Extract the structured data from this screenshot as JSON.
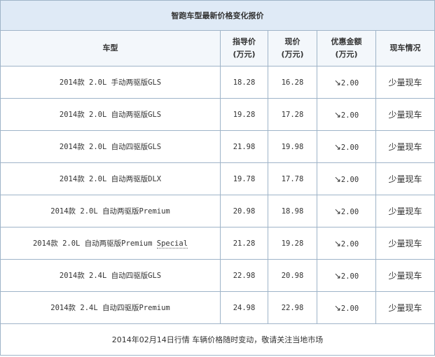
{
  "title": "智跑车型最新价格变化报价",
  "headers": {
    "model": "车型",
    "guide_price": [
      "指导价",
      "(万元)"
    ],
    "current_price": [
      "现价",
      "(万元)"
    ],
    "discount": [
      "优惠金额",
      "(万元)"
    ],
    "stock": "现车情况"
  },
  "rows": [
    {
      "model_main": "2014款 2.0L 手动两驱版GLS",
      "model_extra": "",
      "guide": "18.28",
      "current": "16.28",
      "discount_arrow": "↘",
      "discount": "2.00",
      "stock": "少量现车"
    },
    {
      "model_main": "2014款 2.0L 自动两驱版GLS",
      "model_extra": "",
      "guide": "19.28",
      "current": "17.28",
      "discount_arrow": "↘",
      "discount": "2.00",
      "stock": "少量现车"
    },
    {
      "model_main": "2014款 2.0L 自动四驱版GLS",
      "model_extra": "",
      "guide": "21.98",
      "current": "19.98",
      "discount_arrow": "↘",
      "discount": "2.00",
      "stock": "少量现车"
    },
    {
      "model_main": "2014款 2.0L 自动两驱版DLX",
      "model_extra": "",
      "guide": "19.78",
      "current": "17.78",
      "discount_arrow": "↘",
      "discount": "2.00",
      "stock": "少量现车"
    },
    {
      "model_main": "2014款 2.0L 自动两驱版Premium",
      "model_extra": "",
      "guide": "20.98",
      "current": "18.98",
      "discount_arrow": "↘",
      "discount": "2.00",
      "stock": "少量现车"
    },
    {
      "model_main": "2014款 2.0L 自动两驱版Premium ",
      "model_extra": "Special",
      "guide": "21.28",
      "current": "19.28",
      "discount_arrow": "↘",
      "discount": "2.00",
      "stock": "少量现车"
    },
    {
      "model_main": "2014款 2.4L 自动四驱版GLS",
      "model_extra": "",
      "guide": "22.98",
      "current": "20.98",
      "discount_arrow": "↘",
      "discount": "2.00",
      "stock": "少量现车"
    },
    {
      "model_main": "2014款 2.4L 自动四驱版Premium",
      "model_extra": "",
      "guide": "24.98",
      "current": "22.98",
      "discount_arrow": "↘",
      "discount": "2.00",
      "stock": "少量现车"
    }
  ],
  "footer": "2014年02月14日行情 车辆价格随时变动，敬请关注当地市场"
}
